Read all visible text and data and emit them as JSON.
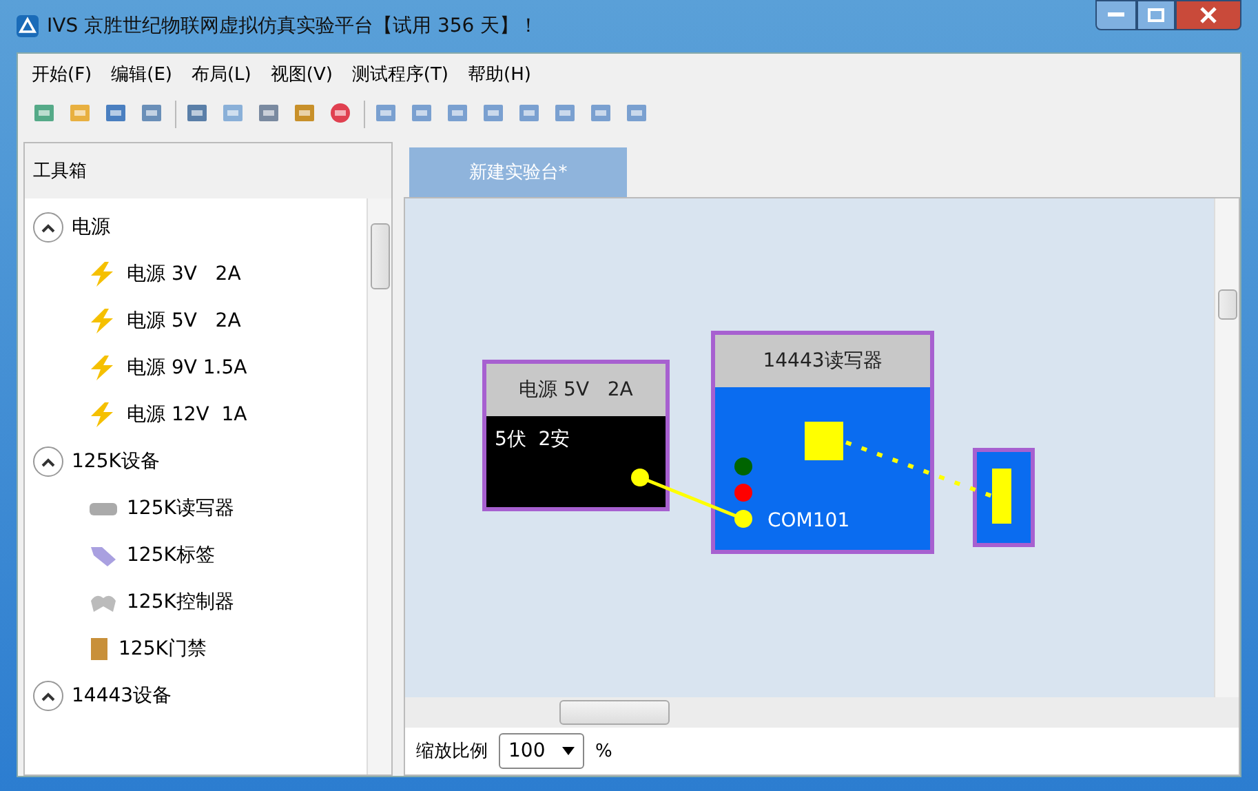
{
  "window": {
    "title": "IVS 京胜世纪物联网虚拟仿真实验平台【试用 356 天】！"
  },
  "menu": [
    "开始(F)",
    "编辑(E)",
    "布局(L)",
    "视图(V)",
    "测试程序(T)",
    "帮助(H)"
  ],
  "toolbar": [
    {
      "kind": "new"
    },
    {
      "kind": "open"
    },
    {
      "kind": "save"
    },
    {
      "kind": "saveall"
    },
    {
      "kind": "sep"
    },
    {
      "kind": "select"
    },
    {
      "kind": "copy"
    },
    {
      "kind": "cut"
    },
    {
      "kind": "paste"
    },
    {
      "kind": "delete"
    },
    {
      "kind": "sep"
    },
    {
      "kind": "aligntop"
    },
    {
      "kind": "alignbottom"
    },
    {
      "kind": "alignleft"
    },
    {
      "kind": "alignright"
    },
    {
      "kind": "centerh"
    },
    {
      "kind": "centerv"
    },
    {
      "kind": "front"
    },
    {
      "kind": "back"
    }
  ],
  "sidebar": {
    "title": "工具箱",
    "groups": [
      {
        "label": "电源",
        "expanded": true,
        "children": [
          {
            "label": "电源 3V   2A",
            "kind": "power"
          },
          {
            "label": "电源 5V   2A",
            "kind": "power"
          },
          {
            "label": "电源 9V 1.5A",
            "kind": "power"
          },
          {
            "label": "电源 12V  1A",
            "kind": "power"
          }
        ]
      },
      {
        "label": "125K设备",
        "expanded": true,
        "children": [
          {
            "label": "125K读写器",
            "kind": "reader"
          },
          {
            "label": "125K标签",
            "kind": "tag"
          },
          {
            "label": "125K控制器",
            "kind": "controller"
          },
          {
            "label": "125K门禁",
            "kind": "door"
          }
        ]
      },
      {
        "label": "14443设备",
        "expanded": true
      }
    ]
  },
  "tabs": [
    {
      "label": "新建实验台*",
      "selected": true
    }
  ],
  "canvas": {
    "power_node": {
      "title": "电源 5V   2A",
      "body": "5伏  2安"
    },
    "reader_node": {
      "title": "14443读写器",
      "port": "COM101",
      "leds": [
        {
          "color": "#006400"
        },
        {
          "color": "#ff0000"
        },
        {
          "color": "#ffff00"
        }
      ]
    }
  },
  "zoom": {
    "label": "缩放比例",
    "value": "100",
    "unit": "%"
  }
}
